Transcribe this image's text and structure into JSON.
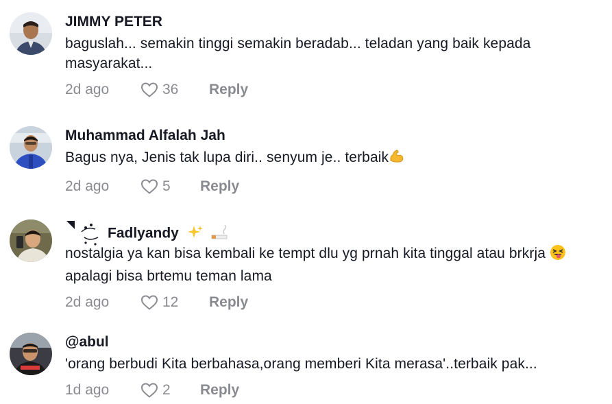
{
  "comments": [
    {
      "username": "JIMMY PETER",
      "text": "baguslah... semakin tinggi semakin beradab... teladan yang baik kepada\nmasyarakat...",
      "time": "2d ago",
      "likes": "36",
      "reply_label": "Reply"
    },
    {
      "username": "Muhammad Alfalah Jah",
      "text": "Bagus nya, Jenis tak lupa diri.. senyum je.. terbaik",
      "text_emoji": "flexed-biceps-emoji",
      "time": "2d ago",
      "likes": "5",
      "reply_label": "Reply"
    },
    {
      "username": "Fadlyandy",
      "username_emojis": [
        "sparkles-emoji",
        "cigarette-emoji"
      ],
      "text_line1": "nostalgia ya kan bisa kembali ke tempt dlu yg prnah kita tinggal atau brkrja",
      "text_line1_emoji": "squinting-tongue-emoji",
      "text_line2": "apalagi bisa brtemu teman lama",
      "time": "2d ago",
      "likes": "12",
      "reply_label": "Reply"
    },
    {
      "username": "@abul",
      "text": "'orang berbudi Kita berbahasa,orang memberi Kita merasa'..terbaik pak...",
      "time": "1d ago",
      "likes": "2",
      "reply_label": "Reply"
    }
  ],
  "colors": {
    "text_primary": "#161823",
    "text_secondary": "#8a8b91",
    "background": "#ffffff"
  }
}
